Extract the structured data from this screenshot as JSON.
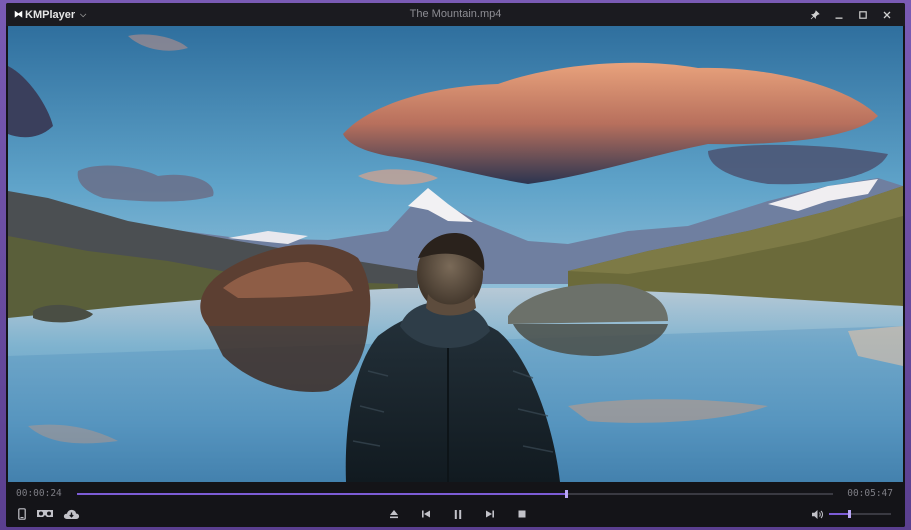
{
  "app": {
    "name": "KMPlayer",
    "logo_mark": "⧓"
  },
  "window": {
    "title": "The Mountain.mp4"
  },
  "playback": {
    "current_time": "00:00:24",
    "total_time": "00:05:47",
    "progress_fraction": 0.647,
    "volume_fraction": 0.33,
    "state": "playing"
  },
  "colors": {
    "accent": "#7c5cd6",
    "chrome_bg": "#141418",
    "titlebar_bg": "#1b1b20",
    "frame": "#6b4fa0"
  },
  "icons": {
    "menu_caret": "chevron-down-icon",
    "pin": "pin-icon",
    "minimize": "minimize-icon",
    "maximize": "maximize-icon",
    "close": "close-icon",
    "left": [
      "mobile-icon",
      "vr-glasses-icon",
      "cloud-download-icon"
    ],
    "center": [
      "eject-icon",
      "previous-icon",
      "pause-icon",
      "next-icon",
      "stop-icon"
    ],
    "right": [
      "volume-icon"
    ]
  }
}
